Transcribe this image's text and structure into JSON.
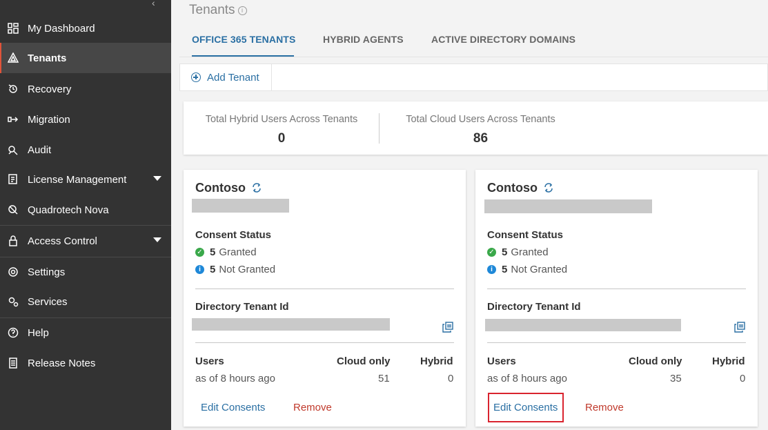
{
  "sidebar": {
    "collapse_label": "‹",
    "items": [
      {
        "label": "My Dashboard",
        "icon": "dashboard-icon"
      },
      {
        "label": "Tenants",
        "icon": "tenants-icon"
      },
      {
        "label": "Recovery",
        "icon": "recovery-icon"
      },
      {
        "label": "Migration",
        "icon": "migration-icon"
      },
      {
        "label": "Audit",
        "icon": "audit-icon"
      },
      {
        "label": "License Management",
        "icon": "license-icon"
      },
      {
        "label": "Quadrotech Nova",
        "icon": "nova-icon"
      },
      {
        "label": "Access Control",
        "icon": "lock-icon"
      },
      {
        "label": "Settings",
        "icon": "gear-icon"
      },
      {
        "label": "Services",
        "icon": "services-icon"
      },
      {
        "label": "Help",
        "icon": "help-icon"
      },
      {
        "label": "Release Notes",
        "icon": "notes-icon"
      }
    ],
    "active": "Tenants"
  },
  "header": {
    "title": "Tenants",
    "info_glyph": "i"
  },
  "tabs": [
    {
      "label": "OFFICE 365 TENANTS",
      "active": true
    },
    {
      "label": "HYBRID AGENTS",
      "active": false
    },
    {
      "label": "ACTIVE DIRECTORY DOMAINS",
      "active": false
    }
  ],
  "toolbar": {
    "add_tenant_label": "Add Tenant"
  },
  "stats": {
    "hybrid_label": "Total Hybrid Users Across Tenants",
    "hybrid_value": "0",
    "cloud_label": "Total Cloud Users Across Tenants",
    "cloud_value": "86"
  },
  "cards": [
    {
      "name": "Contoso",
      "consent_heading": "Consent Status",
      "granted_count": "5",
      "granted_label": "Granted",
      "not_granted_count": "5",
      "not_granted_label": "Not Granted",
      "directory_heading": "Directory Tenant Id",
      "users_heading": "Users",
      "users_sub": "as of 8 hours ago",
      "cloud_heading": "Cloud only",
      "cloud_value": "51",
      "hybrid_heading": "Hybrid",
      "hybrid_value": "0",
      "edit_label": "Edit Consents",
      "remove_label": "Remove"
    },
    {
      "name": "Contoso",
      "consent_heading": "Consent Status",
      "granted_count": "5",
      "granted_label": "Granted",
      "not_granted_count": "5",
      "not_granted_label": "Not Granted",
      "directory_heading": "Directory Tenant Id",
      "users_heading": "Users",
      "users_sub": "as of 8 hours ago",
      "cloud_heading": "Cloud only",
      "cloud_value": "35",
      "hybrid_heading": "Hybrid",
      "hybrid_value": "0",
      "edit_label": "Edit Consents",
      "remove_label": "Remove"
    }
  ],
  "colors": {
    "sidebar_bg": "#333333",
    "accent_blue": "#2a6fa3",
    "remove_red": "#c0392b",
    "highlight_red": "#d9232e",
    "granted_green": "#3aa84a",
    "info_blue": "#1e88d8"
  }
}
